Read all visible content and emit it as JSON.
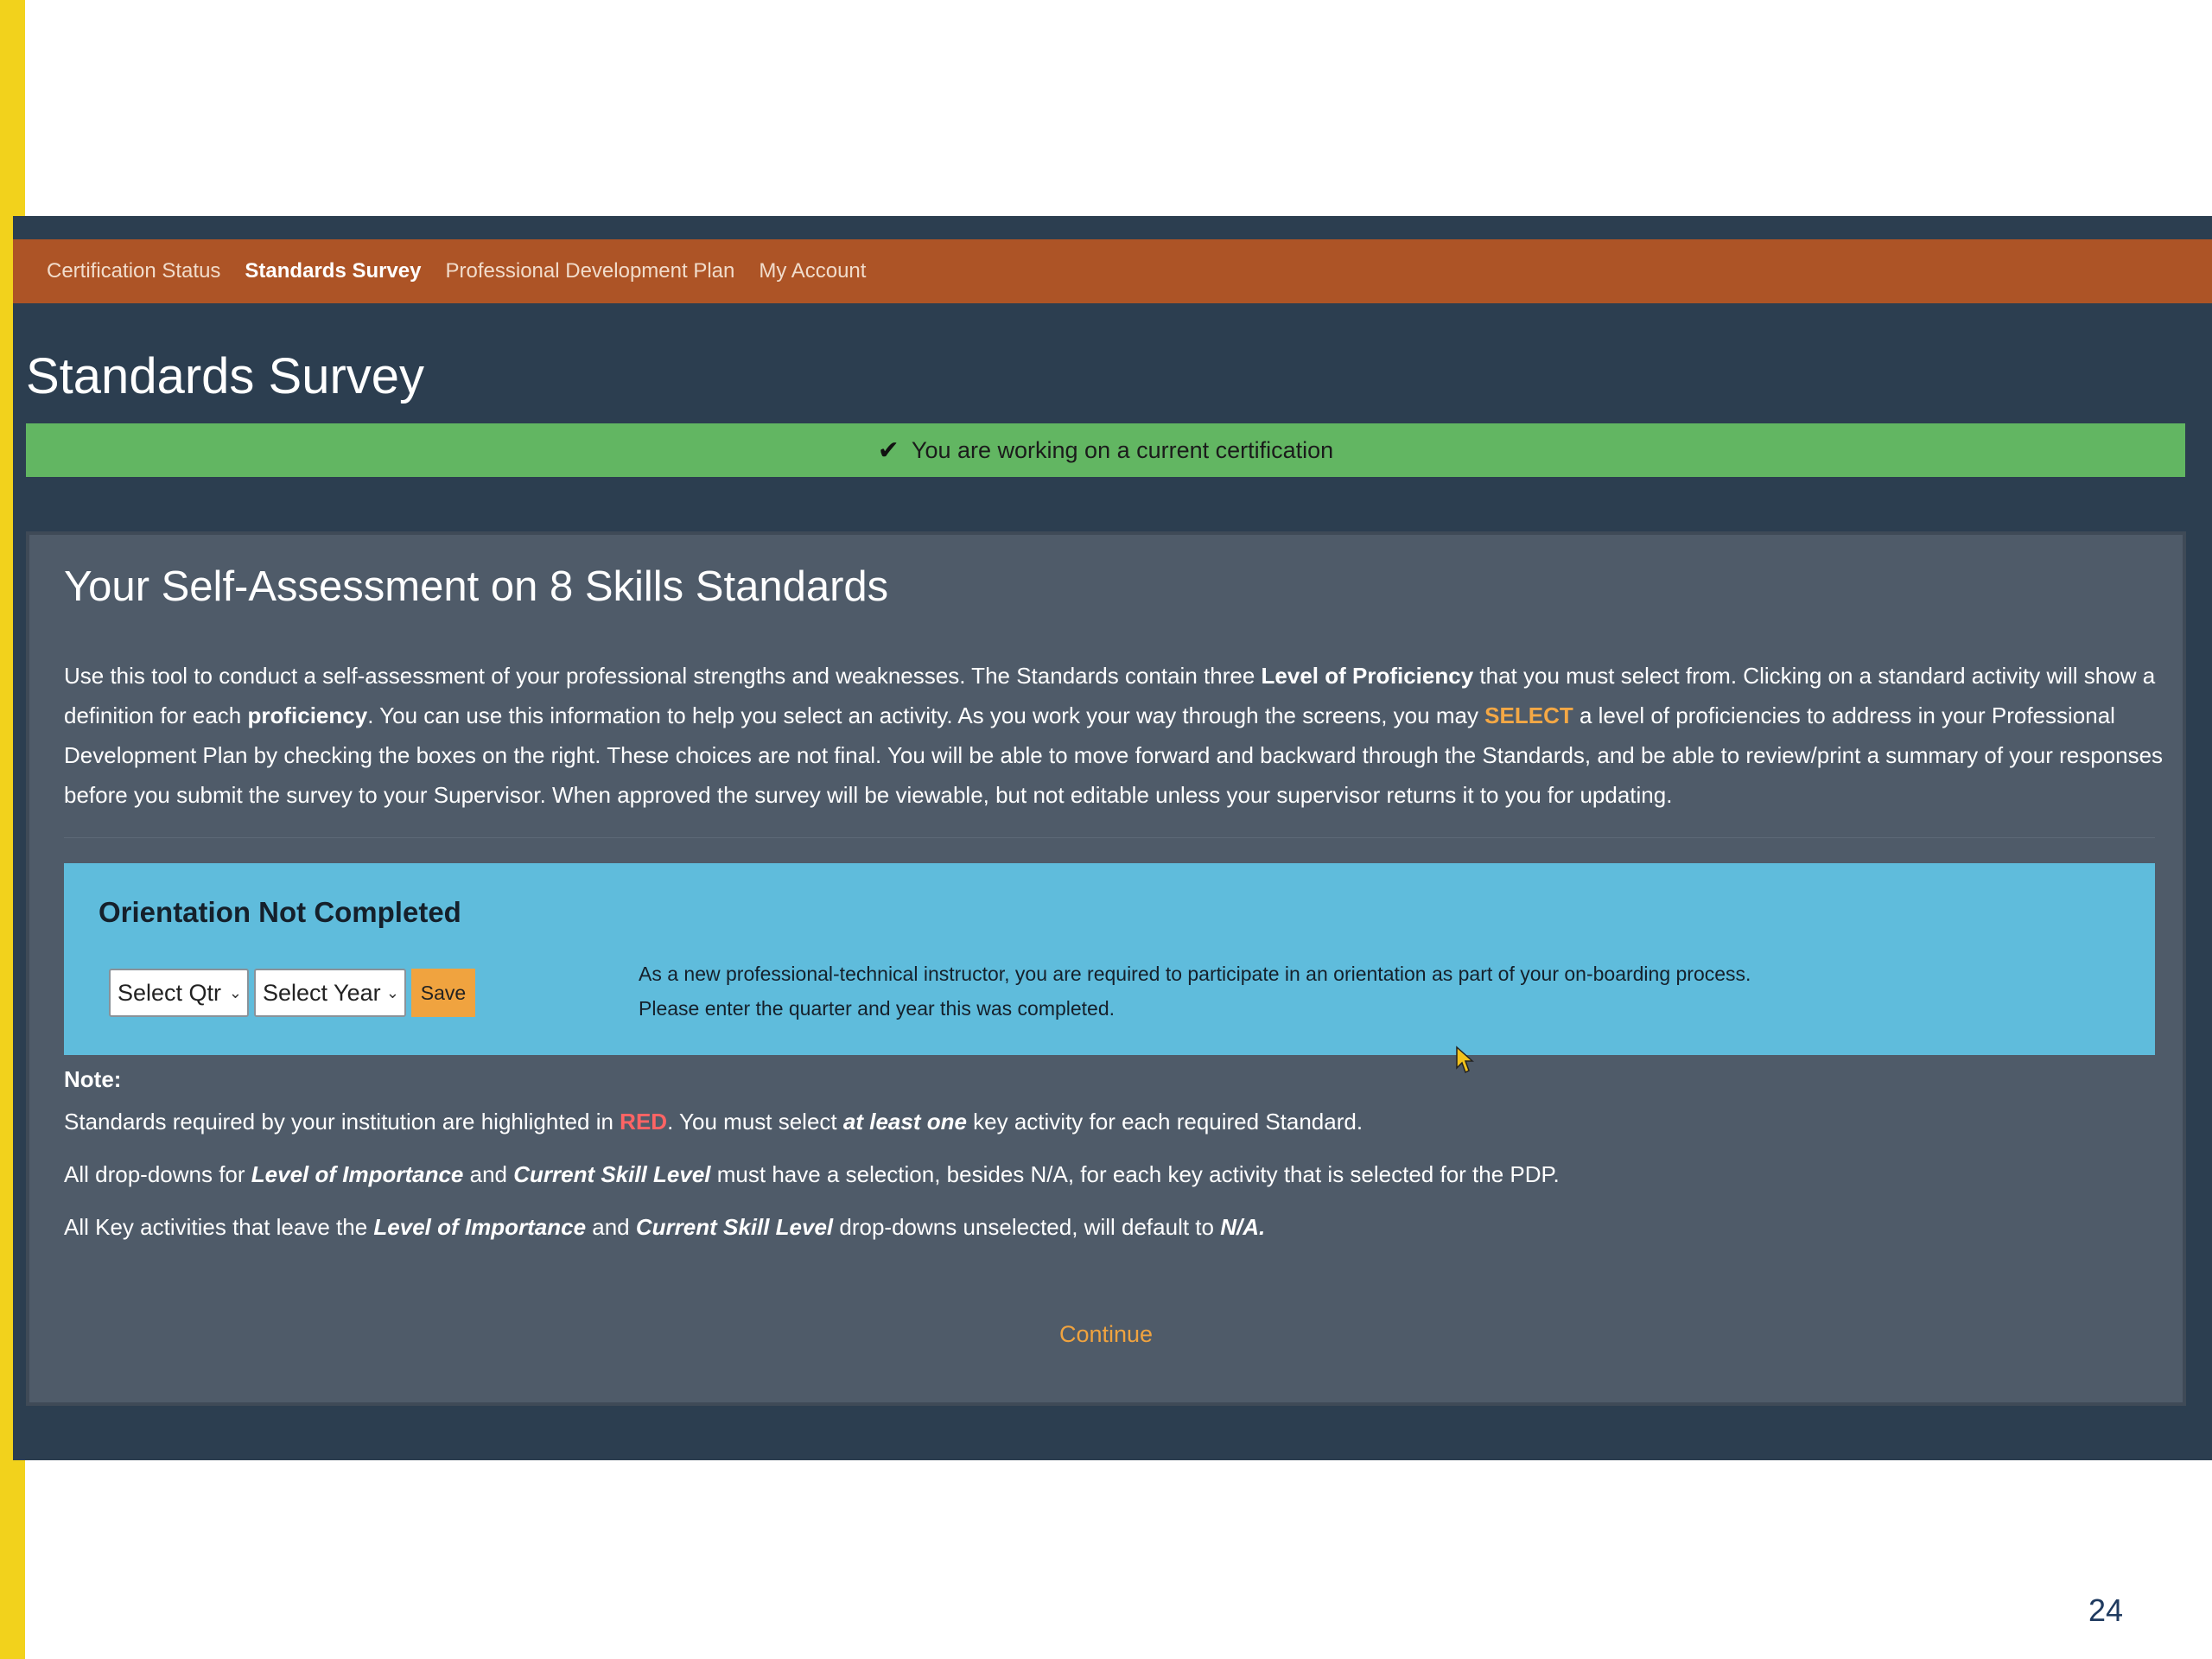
{
  "nav": {
    "items": [
      {
        "label": "Certification Status"
      },
      {
        "label": "Standards Survey"
      },
      {
        "label": "Professional Development Plan"
      },
      {
        "label": "My Account"
      }
    ]
  },
  "page_title": "Standards Survey",
  "status_banner": {
    "icon": "check-icon",
    "text": "You are working on a current certification"
  },
  "panel": {
    "title": "Your Self-Assessment on 8 Skills Standards",
    "intro": {
      "p1": "Use this tool to conduct a self-assessment of your professional strengths and weaknesses. The Standards contain three ",
      "b1": "Level of Proficiency",
      "p2": " that you must select from. Clicking on a standard activity will show a definition for each ",
      "b2": "proficiency",
      "p3": ". You can use this information to help you select an activity. As you work your way through the screens, you may ",
      "select_word": "SELECT",
      "p4": " a level of proficiencies to address in your Professional Development Plan by checking the boxes on the right. These choices are not final. You will be able to move forward and backward through the Standards, and be able to review/print a summary of your responses before you submit the survey to your Supervisor. When approved the survey will be viewable, but not editable unless your supervisor returns it to you for updating."
    }
  },
  "orientation": {
    "title": "Orientation Not Completed",
    "qtr_select": "Select Qtr",
    "year_select": "Select Year",
    "save_label": "Save",
    "message_line1": "As a new professional-technical instructor, you are required to participate in an orientation as part of your on-boarding process.",
    "message_line2": "Please enter the quarter and year this was completed."
  },
  "note": {
    "label": "Note:",
    "line1": {
      "a": "Standards required by your institution are highlighted in ",
      "red": "RED",
      "b": ". You must select ",
      "em": "at least one",
      "c": " key activity for each required Standard."
    },
    "line2": {
      "a": "All drop-downs for ",
      "em1": "Level of Importance",
      "b": " and ",
      "em2": "Current Skill Level",
      "c": " must have a selection, besides N/A, for each key activity that is selected for the PDP."
    },
    "line3": {
      "a": "All Key activities that leave the ",
      "em1": "Level of Importance",
      "b": " and ",
      "em2": "Current Skill Level",
      "c": " drop-downs unselected, will default to ",
      "em3": "N/A."
    }
  },
  "continue_label": "Continue",
  "page_number": "24",
  "colors": {
    "nav_bg": "#ad5426",
    "app_bg": "#2c3e50",
    "banner_green": "#62b662",
    "orientation_blue": "#5fbcdc",
    "accent_orange": "#f0a33f",
    "highlight_red": "#ff6464",
    "slide_yellow": "#f2d21c"
  }
}
